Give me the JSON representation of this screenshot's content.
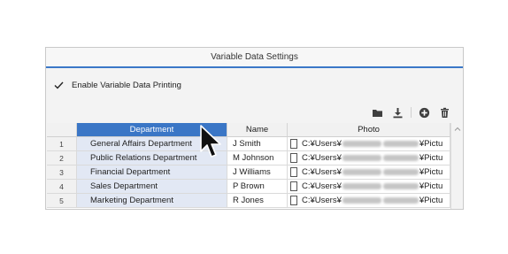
{
  "dialog": {
    "title": "Variable Data Settings"
  },
  "enable": {
    "label": "Enable Variable Data Printing",
    "checked": true
  },
  "toolbar": {
    "icons": [
      "folder-icon",
      "download-icon",
      "add-circle-icon",
      "trash-icon"
    ]
  },
  "table": {
    "columns": [
      "Department",
      "Name",
      "Photo"
    ],
    "selected_column": "Department",
    "rows": [
      {
        "num": "1",
        "department": "General Affairs Department",
        "name": "J Smith",
        "photo_start": "C:¥Users¥",
        "photo_end": "¥Pictu"
      },
      {
        "num": "2",
        "department": "Public Relations Department",
        "name": "M Johnson",
        "photo_start": "C:¥Users¥",
        "photo_end": "¥Pictu"
      },
      {
        "num": "3",
        "department": "Financial Department",
        "name": "J Williams",
        "photo_start": "C:¥Users¥",
        "photo_end": "¥Pictu"
      },
      {
        "num": "4",
        "department": "Sales Department",
        "name": "P Brown",
        "photo_start": "C:¥Users¥",
        "photo_end": "¥Pictu"
      },
      {
        "num": "5",
        "department": "Marketing Department",
        "name": "R Jones",
        "photo_start": "C:¥Users¥",
        "photo_end": "¥Pictu"
      }
    ]
  },
  "colors": {
    "accent": "#3a76c6",
    "department_cell": "#e2e8f4"
  }
}
